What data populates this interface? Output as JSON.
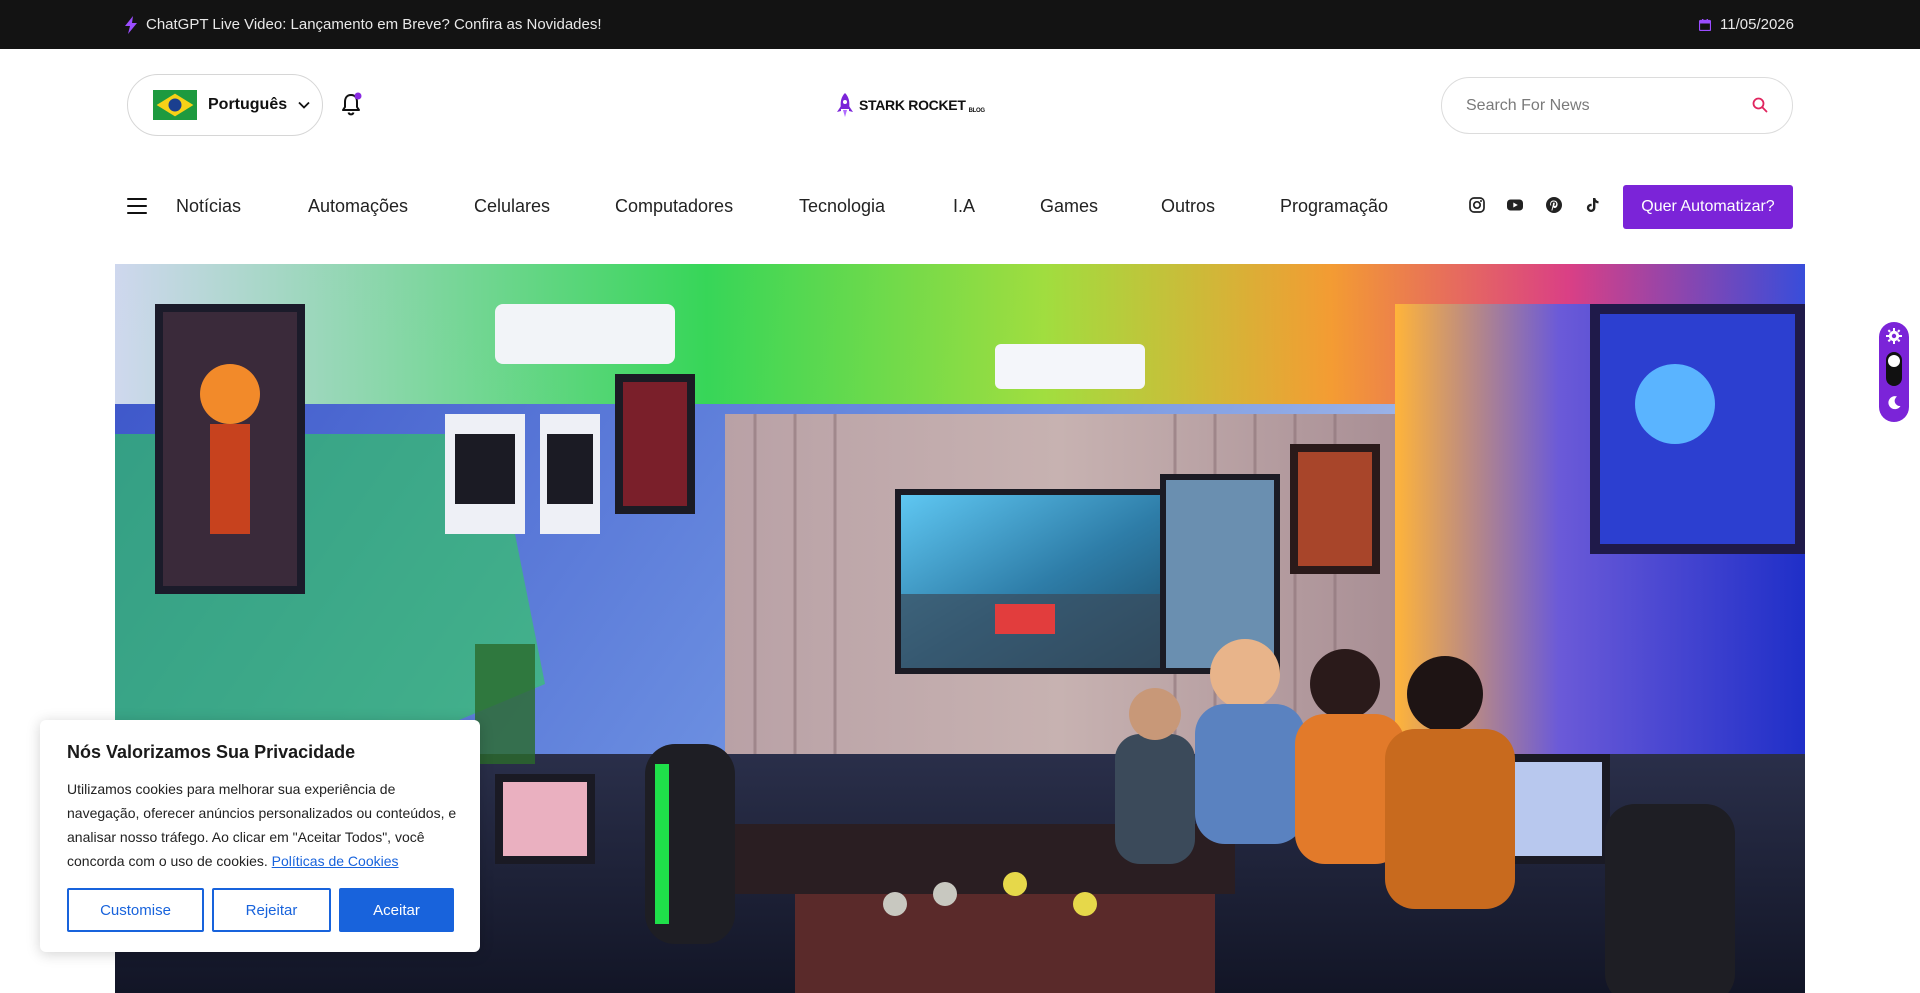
{
  "topbar": {
    "headline": "ChatGPT Live Video: Lançamento em Breve? Confira as Novidades!",
    "date": "11/05/2026"
  },
  "header": {
    "language_label": "Português",
    "logo_text": "STARK ROCKET",
    "logo_suffix": "BLOG",
    "search_placeholder": "Search For News"
  },
  "nav": {
    "items": [
      "Notícias",
      "Automações",
      "Celulares",
      "Computadores",
      "Tecnologia",
      "I.A",
      "Games",
      "Outros",
      "Programação"
    ],
    "cta_label": "Quer Automatizar?",
    "social_icons": [
      "instagram-icon",
      "youtube-icon",
      "pinterest-icon",
      "tiktok-icon"
    ]
  },
  "cookie": {
    "title": "Nós Valorizamos Sua Privacidade",
    "body": "Utilizamos cookies para melhorar sua experiência de navegação, oferecer anúncios personalizados ou conteúdos, e analisar nosso tráfego. Ao clicar em \"Aceitar Todos\", você concorda com o uso de cookies.",
    "link_label": "Políticas de Cookies",
    "customise_label": "Customise",
    "reject_label": "Rejeitar",
    "accept_label": "Aceitar"
  },
  "colors": {
    "accent": "#7b24d8",
    "topbar_bg": "#131313",
    "cookie_blue": "#1863dc"
  }
}
